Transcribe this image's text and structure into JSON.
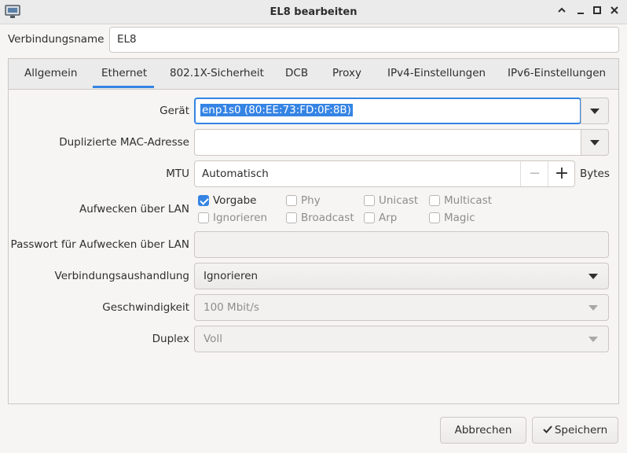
{
  "window": {
    "title": "EL8 bearbeiten"
  },
  "connection": {
    "name_label": "Verbindungsname",
    "name_value": "EL8"
  },
  "tabs": [
    {
      "label": "Allgemein"
    },
    {
      "label": "Ethernet"
    },
    {
      "label": "802.1X-Sicherheit"
    },
    {
      "label": "DCB"
    },
    {
      "label": "Proxy"
    },
    {
      "label": "IPv4-Einstellungen"
    },
    {
      "label": "IPv6-Einstellungen"
    }
  ],
  "ethernet": {
    "device_label": "Gerät",
    "device_value": "enp1s0 (80:EE:73:FD:0F:8B)",
    "cloned_mac_label": "Duplizierte MAC-Adresse",
    "cloned_mac_value": "",
    "mtu_label": "MTU",
    "mtu_value": "Automatisch",
    "mtu_unit": "Bytes",
    "mtu_minus": "−",
    "mtu_plus": "+",
    "wol_label": "Aufwecken über LAN",
    "wol_options": [
      {
        "label": "Vorgabe",
        "checked": true
      },
      {
        "label": "Phy",
        "checked": false
      },
      {
        "label": "Unicast",
        "checked": false
      },
      {
        "label": "Multicast",
        "checked": false
      },
      {
        "label": "Ignorieren",
        "checked": false
      },
      {
        "label": "Broadcast",
        "checked": false
      },
      {
        "label": "Arp",
        "checked": false
      },
      {
        "label": "Magic",
        "checked": false
      }
    ],
    "wol_password_label": "Passwort für Aufwecken über LAN",
    "wol_password_value": "",
    "negotiation_label": "Verbindungsaushandlung",
    "negotiation_value": "Ignorieren",
    "speed_label": "Geschwindigkeit",
    "speed_value": "100 Mbit/s",
    "duplex_label": "Duplex",
    "duplex_value": "Voll"
  },
  "footer": {
    "cancel_label": "Abbrechen",
    "save_label": "Speichern",
    "save_icon": "checkmark-icon"
  },
  "colors": {
    "accent": "#3584e4",
    "selection": "#3584e4"
  }
}
